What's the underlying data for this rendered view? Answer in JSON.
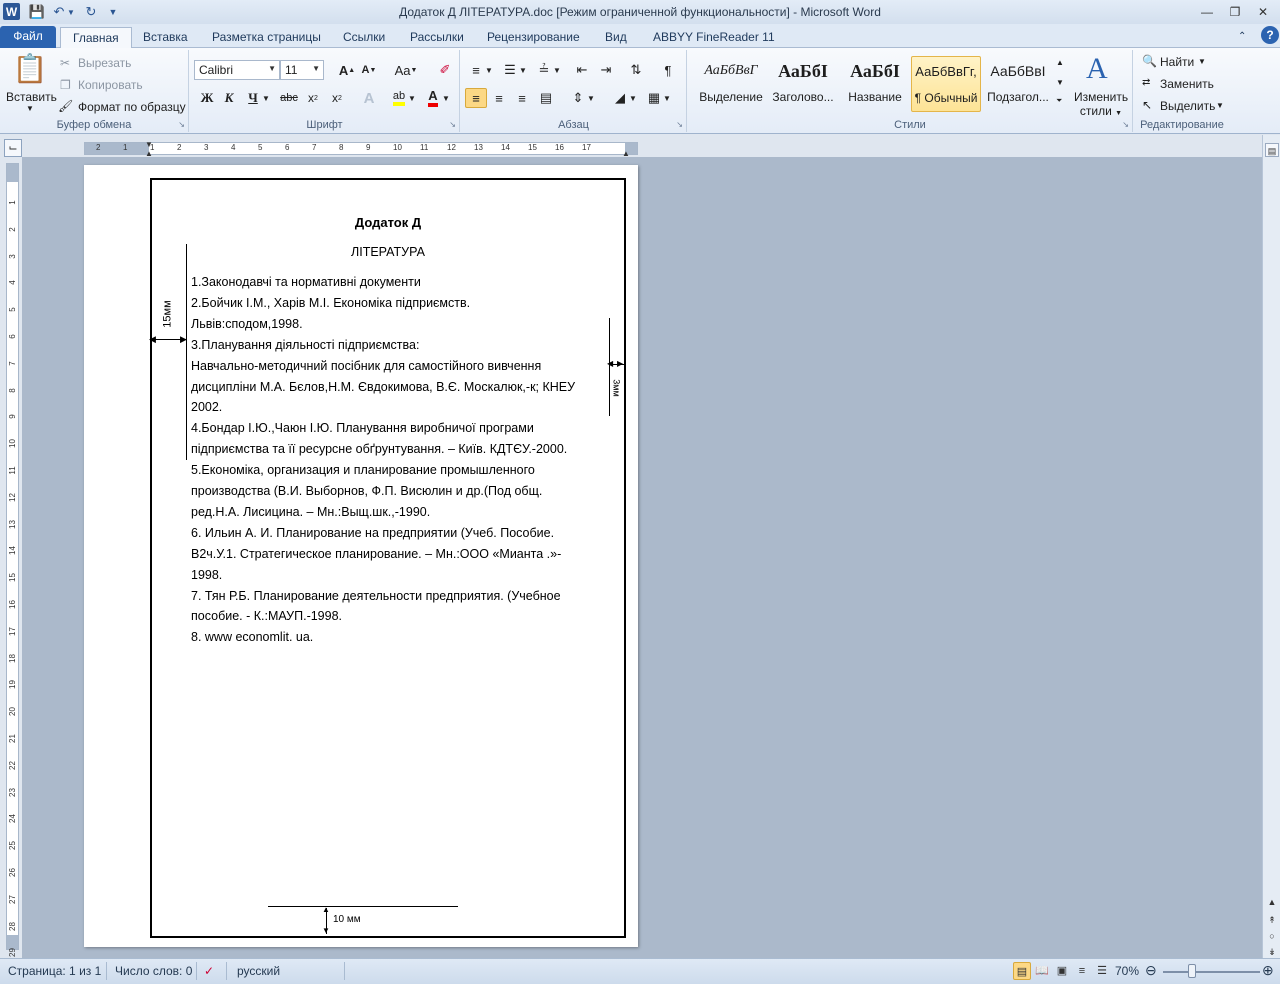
{
  "window": {
    "title": "Додаток Д ЛІТЕРАТУРА.doc [Режим ограниченной функциональности]  -  Microsoft Word"
  },
  "tabs": [
    {
      "label": "Файл"
    },
    {
      "label": "Главная"
    },
    {
      "label": "Вставка"
    },
    {
      "label": "Разметка страницы"
    },
    {
      "label": "Ссылки"
    },
    {
      "label": "Рассылки"
    },
    {
      "label": "Рецензирование"
    },
    {
      "label": "Вид"
    },
    {
      "label": "ABBYY FineReader 11"
    }
  ],
  "ribbon": {
    "clipboard": {
      "label": "Буфер обмена",
      "paste": "Вставить",
      "cut": "Вырезать",
      "copy": "Копировать",
      "format_painter": "Формат по образцу"
    },
    "font": {
      "label": "Шрифт",
      "font_name": "Calibri",
      "font_size": "11"
    },
    "paragraph": {
      "label": "Абзац"
    },
    "styles": {
      "label": "Стили",
      "items": [
        {
          "sample": "АаБбВвГ",
          "name": "Выделение"
        },
        {
          "sample": "АаБбІ",
          "name": "Заголово..."
        },
        {
          "sample": "АаБбІ",
          "name": "Название"
        },
        {
          "sample": "АаБбВвГг,",
          "name": "¶ Обычный"
        },
        {
          "sample": "АаБбВвІ",
          "name": "Подзагол..."
        }
      ],
      "change_styles_line1": "Изменить",
      "change_styles_line2": "стили"
    },
    "editing": {
      "label": "Редактирование",
      "find": "Найти",
      "replace": "Заменить",
      "select": "Выделить"
    }
  },
  "ruler": {
    "horizontal_ticks": [
      "2",
      "1",
      "1",
      "2",
      "3",
      "4",
      "5",
      "6",
      "7",
      "8",
      "9",
      "10",
      "11",
      "12",
      "13",
      "14",
      "15",
      "16",
      "17"
    ],
    "vertical_ticks": [
      "1",
      "2",
      "3",
      "4",
      "5",
      "6",
      "7",
      "8",
      "9",
      "10",
      "11",
      "12",
      "13",
      "14",
      "15",
      "16",
      "17",
      "18",
      "19",
      "20",
      "21",
      "22",
      "23",
      "24",
      "25",
      "26",
      "27",
      "28",
      "29"
    ]
  },
  "document": {
    "heading": "Додаток Д",
    "subheading": "ЛІТЕРАТУРА",
    "lines": [
      "1.Законодавчі та нормативні документи",
      "2.Бойчик І.М., Харів М.І. Економіка підприємств.",
      "Львів:сподом,1998.",
      "3.Планування діяльності підприємства:",
      "Навчально-методичний посібник для самостійного вивчення",
      "дисципліни М.А. Бєлов,Н.М. Євдокимова, В.Є. Москалюк,-к; КНЕУ",
      "2002.",
      "4.Бондар І.Ю.,Чаюн І.Ю. Планування виробничої програми",
      "підприємства та її ресурсне обґрунтування. – Київ. КДТЄУ.-2000.",
      "5.Економіка, организация и планирование промышленного",
      "производства (В.И. Выборнов, Ф.П. Висюлин и др.(Под общ.",
      "ред.Н.А. Лисицина. – Мн.:Выщ.шк.,-1990.",
      "6. Ильин  А. И.   Планирование на предприятии (Учеб. Пособие.",
      "В2ч.У.1. Стратегическое планирование. – Мн.:ООО «Мианта .»-",
      "1998.",
      "7. Тян Р.Б. Планирование деятельности предприятия. (Учебное",
      "пособие. - К.:МАУП.-1998.",
      "8.  www economlit. ua."
    ],
    "annotation_left": "15мм",
    "annotation_right": "3мм",
    "annotation_bottom": "10 мм"
  },
  "status": {
    "page": "Страница: 1 из 1",
    "words": "Число слов: 0",
    "language": "русский",
    "zoom": "70%",
    "zoom_fraction": 0.3
  }
}
